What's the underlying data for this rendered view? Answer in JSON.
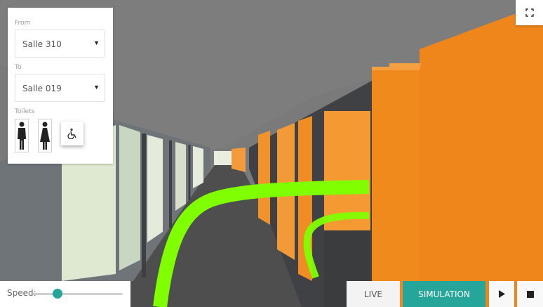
{
  "route": {
    "from_label": "From",
    "from_value": "Salle 310",
    "to_label": "To",
    "to_value": "Salle 019",
    "toilets_label": "Toilets"
  },
  "icons": {
    "dropdown_from": "chevron-down-icon",
    "dropdown_to": "chevron-down-icon",
    "toilet_men": "men-toilet-icon",
    "toilet_women": "women-toilet-icon",
    "accessibility": "wheelchair-icon",
    "fullscreen": "fullscreen-icon",
    "play": "play-icon",
    "stop": "stop-icon"
  },
  "playback": {
    "speed_label": "Speed:",
    "speed_level": 0.28,
    "live_label": "LIVE",
    "simulation_label": "SIMULATION",
    "active_mode": "SIMULATION"
  },
  "colors": {
    "accent": "#26a69a",
    "path": "#7fff00",
    "room_orange": "#f08a1c",
    "ceiling": "#7d7d7d",
    "floor": "#4e4e4e",
    "wall_left": "#6e7479"
  }
}
